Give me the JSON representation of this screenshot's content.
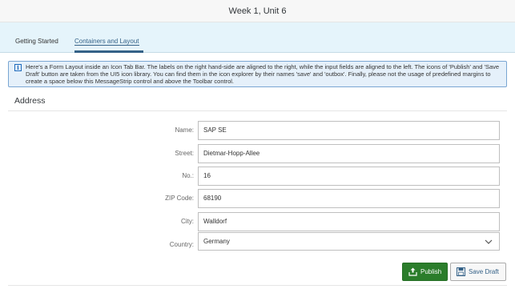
{
  "header": {
    "title": "Week 1, Unit 6"
  },
  "tabs": [
    {
      "label": "Getting Started",
      "selected": false
    },
    {
      "label": "Containers and Layout",
      "selected": true
    }
  ],
  "message_strip": {
    "type": "information",
    "icon": "info-icon",
    "text": "Here's a Form Layout inside an Icon Tab Bar. The labels on the right hand-side are aligned to the right, while the input fields are aligned to the left. The icons of 'Publish' and 'Save Draft' button are taken from the UI5 icon library. You can find them in the icon explorer by their names 'save' and 'outbox'. Finally, please not the usage of predefined margins to create a space below this MessageStrip control and above the Toolbar control."
  },
  "form": {
    "title": "Address",
    "fields": [
      {
        "label": "Name:",
        "value": "SAP SE"
      },
      {
        "label": "Street:",
        "value": "Dietmar-Hopp-Allee"
      },
      {
        "label": "No.:",
        "value": "16"
      },
      {
        "label": "ZIP Code:",
        "value": "68190"
      },
      {
        "label": "City:",
        "value": "Walldorf"
      },
      {
        "label": "Country:",
        "value": "Germany"
      }
    ]
  },
  "toolbar": {
    "publish_label": "Publish",
    "publish_icon": "outbox-icon",
    "save_draft_label": "Save Draft",
    "save_draft_icon": "save-icon"
  },
  "colors": {
    "tabbar_bg": "#e5f4fb",
    "selected_tab": "#346187",
    "publish_button": "#2b7d2b",
    "message_strip_border": "#7aa6d3"
  }
}
